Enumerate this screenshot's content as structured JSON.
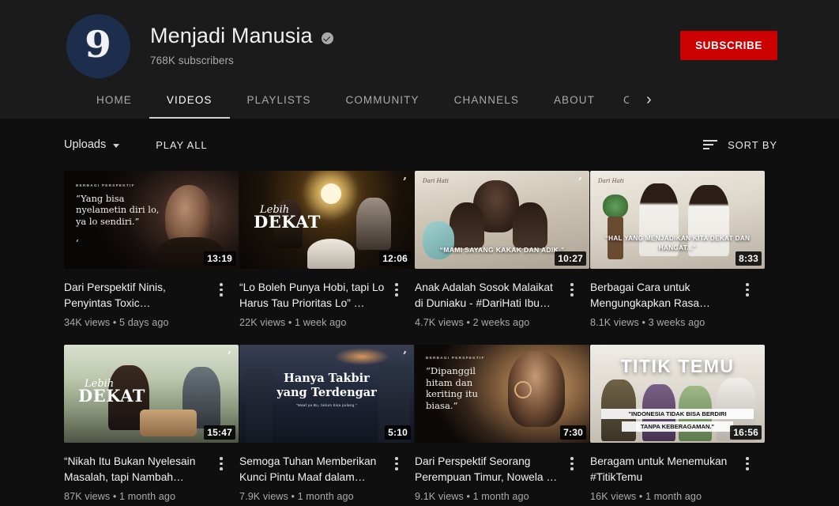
{
  "channel": {
    "name": "Menjadi Manusia",
    "subscribers": "768K subscribers",
    "verified_icon": "verified-badge-icon",
    "avatar_glyph": "9",
    "subscribe_label": "SUBSCRIBE",
    "subscribe_color": "#cc0000"
  },
  "tabs": [
    {
      "label": "HOME",
      "active": false
    },
    {
      "label": "VIDEOS",
      "active": true
    },
    {
      "label": "PLAYLISTS",
      "active": false
    },
    {
      "label": "COMMUNITY",
      "active": false
    },
    {
      "label": "CHANNELS",
      "active": false
    },
    {
      "label": "ABOUT",
      "active": false
    }
  ],
  "tab_overflow": {
    "clipped_label": "C",
    "next_icon": "chevron-right-icon"
  },
  "filter_bar": {
    "uploads_label": "Uploads",
    "caret_icon": "chevron-down-icon",
    "play_all_label": "PLAY ALL",
    "sort_label": "SORT BY",
    "sort_icon": "sort-lines-icon"
  },
  "videos": [
    {
      "title": "Dari Perspektif Ninis, Penyintas Toxic…",
      "duration": "13:19",
      "views": "34K views",
      "age": "5 days ago",
      "meta": "34K views • 5 days ago",
      "thumb_eyebrow": "BERBAGI PERSPEKTIF",
      "thumb_quote": "“Yang bisa nyelametin diri lo, ya lo sendiri.”"
    },
    {
      "title": "“Lo Boleh Punya Hobi, tapi Lo Harus Tau Prioritas Lo” …",
      "duration": "12:06",
      "views": "22K views",
      "age": "1 week ago",
      "meta": "22K views • 1 week ago",
      "thumb_title_script": "Lebih",
      "thumb_title_main": "DEKAT"
    },
    {
      "title": "Anak Adalah Sosok Malaikat di Duniaku - #DariHati Ibu…",
      "duration": "10:27",
      "views": "4.7K views",
      "age": "2 weeks ago",
      "meta": "4.7K views • 2 weeks ago",
      "thumb_corner": "Dari Hati",
      "thumb_caption": "“MAMI SAYANG KAKAK DAN ADIK.”"
    },
    {
      "title": "Berbagai Cara untuk Mengungkapkan Rasa…",
      "duration": "8:33",
      "views": "8.1K views",
      "age": "3 weeks ago",
      "meta": "8.1K views • 3 weeks ago",
      "thumb_corner": "Dari Hati",
      "thumb_caption": "“HAL YANG MENJADIKAN KITA DEKAT DAN HANGAT...”"
    },
    {
      "title": "“Nikah Itu Bukan Nyelesain Masalah, tapi Nambah…",
      "duration": "15:47",
      "views": "87K views",
      "age": "1 month ago",
      "meta": "87K views • 1 month ago",
      "thumb_title_script": "Lebih",
      "thumb_title_main": "DEKAT"
    },
    {
      "title": "Semoga Tuhan Memberikan Kunci Pintu Maaf dalam…",
      "duration": "5:10",
      "views": "7.9K views",
      "age": "1 month ago",
      "meta": "7.9K views • 1 month ago",
      "thumb_headline_1": "Hanya Takbir",
      "thumb_headline_2": "yang Terdengar",
      "thumb_sub": "\"Maaf ya Bu, belum bisa pulang.\""
    },
    {
      "title": "Dari Perspektif Seorang Perempuan Timur, Nowela …",
      "duration": "7:30",
      "views": "9.1K views",
      "age": "1 month ago",
      "meta": "9.1K views • 1 month ago",
      "thumb_eyebrow": "BERBAGI PERSPEKTIF",
      "thumb_quote": "“Dipanggil hitam dan keriting itu biasa.”"
    },
    {
      "title": "Beragam untuk Menemukan #TitikTemu",
      "duration": "16:56",
      "views": "16K views",
      "age": "1 month ago",
      "meta": "16K views • 1 month ago",
      "thumb_headline": "TITIK TEMU",
      "thumb_caption_1": "\"INDONESIA TIDAK BISA BERDIRI",
      "thumb_caption_2": "TANPA KEBERAGAMAN.\""
    }
  ],
  "menu_icon": "kebab-menu-icon"
}
